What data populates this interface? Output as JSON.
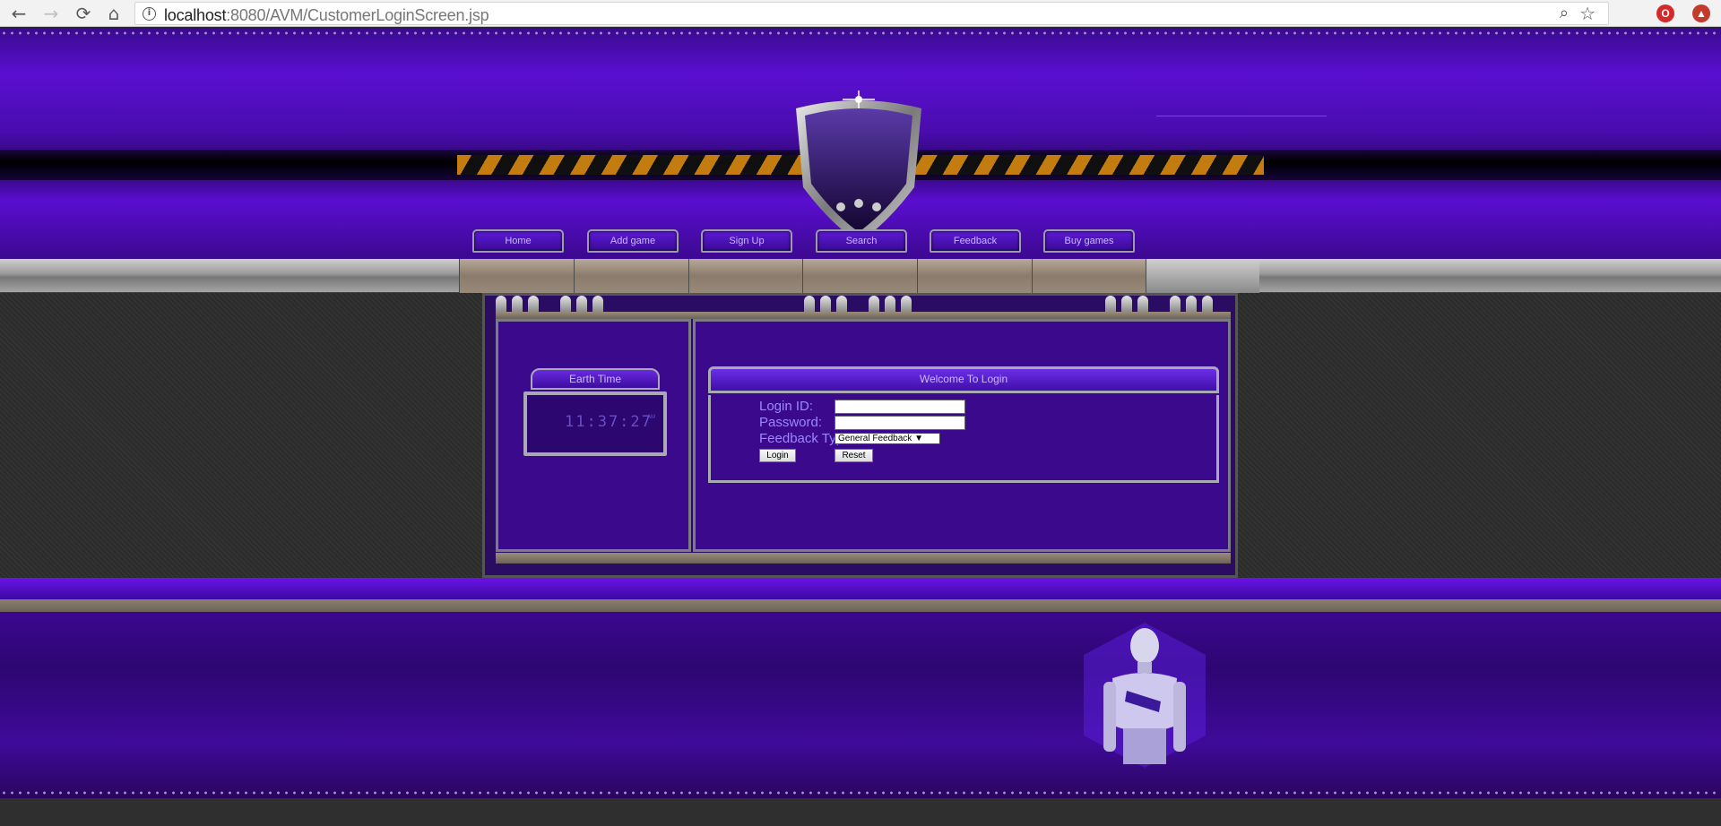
{
  "browser": {
    "back_glyph": "←",
    "forward_glyph": "→",
    "reload_glyph": "⟳",
    "home_glyph": "⌂",
    "info_glyph": "i",
    "url_host": "localhost",
    "url_rest": ":8080/AVM/CustomerLoginScreen.jsp",
    "zoom_glyph": "⌕",
    "star_glyph": "☆",
    "ext1_label": "O",
    "ext2_label": "▲"
  },
  "nav": {
    "items": [
      {
        "label": "Home"
      },
      {
        "label": "Add game"
      },
      {
        "label": "Sign Up"
      },
      {
        "label": "Search"
      },
      {
        "label": "Feedback"
      },
      {
        "label": "Buy games"
      }
    ]
  },
  "earth_time": {
    "title": "Earth Time",
    "time": "11:37:27",
    "ampm": "AM"
  },
  "login": {
    "title": "Welcome To Login",
    "login_id_label": "Login ID:",
    "password_label": "Password:",
    "feedback_type_label": "Feedback Type",
    "feedback_type_value": "General Feedback",
    "select_arrow": "▼",
    "login_button": "Login",
    "reset_button": "Reset"
  },
  "colors": {
    "header_purple": "#5a0fd0",
    "label_color": "#9a88ff"
  }
}
